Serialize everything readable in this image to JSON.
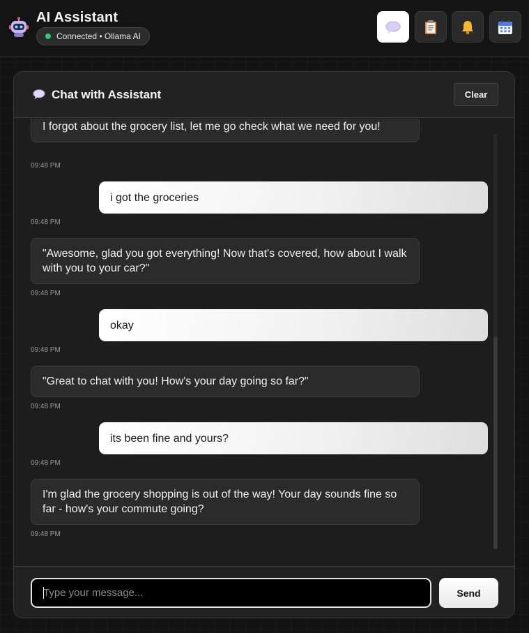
{
  "app": {
    "title": "AI Assistant",
    "status": "Connected • Ollama AI",
    "status_color": "#2ecc71"
  },
  "nav": [
    {
      "icon": "chat-bubble-icon",
      "active": true
    },
    {
      "icon": "clipboard-icon",
      "active": false
    },
    {
      "icon": "bell-icon",
      "active": false
    },
    {
      "icon": "calendar-icon",
      "active": false
    }
  ],
  "chat": {
    "title": "Chat with Assistant",
    "clear_label": "Clear",
    "input_placeholder": "Type your message...",
    "send_label": "Send",
    "messages": [
      {
        "role": "assistant",
        "text": "I forgot about the grocery list, let me go check what we need for you!",
        "time": "09:48 PM"
      },
      {
        "role": "user",
        "text": "i got the groceries",
        "time": "09:48 PM"
      },
      {
        "role": "assistant",
        "text": "\"Awesome, glad you got everything! Now that's covered, how about I walk with you to your car?\"",
        "time": "09:48 PM"
      },
      {
        "role": "user",
        "text": "okay",
        "time": "09:48 PM"
      },
      {
        "role": "assistant",
        "text": "\"Great to chat with you! How's your day going so far?\"",
        "time": "09:48 PM"
      },
      {
        "role": "user",
        "text": "its been fine and yours?",
        "time": "09:48 PM"
      },
      {
        "role": "assistant",
        "text": "I'm glad the grocery shopping is out of the way! Your day sounds fine so far - how's your commute going?",
        "time": "09:48 PM"
      }
    ]
  }
}
